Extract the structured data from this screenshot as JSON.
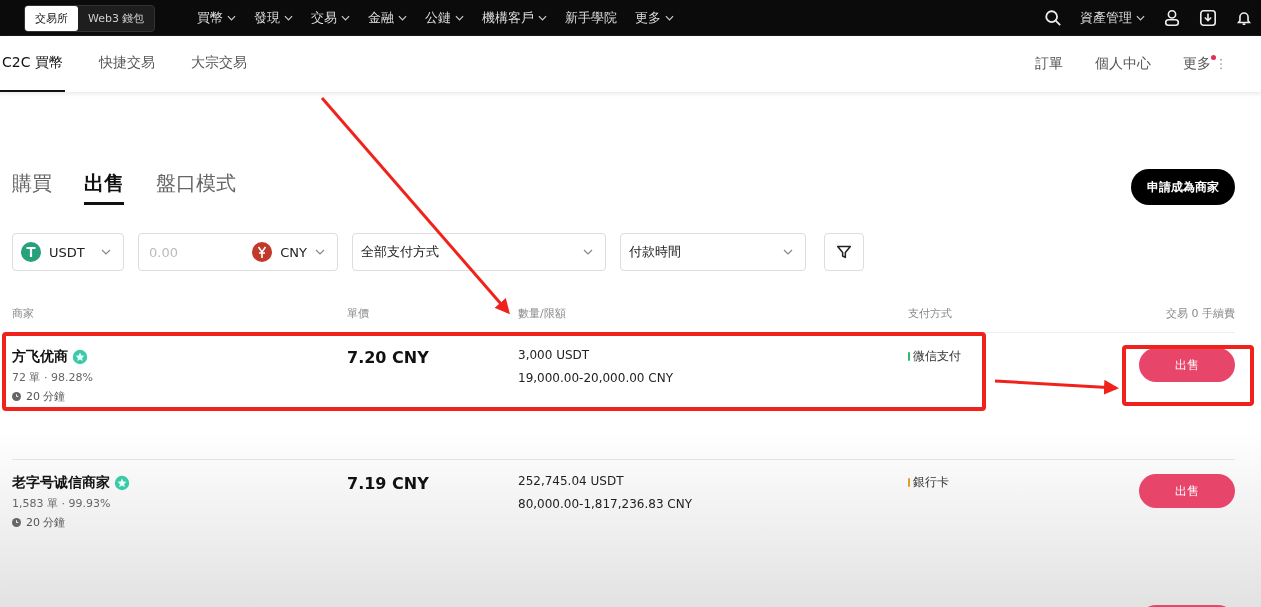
{
  "top_nav": {
    "switch": [
      {
        "label": "交易所",
        "selected": true
      },
      {
        "label": "Web3 錢包",
        "selected": false
      }
    ],
    "menu": [
      "買幣",
      "發現",
      "交易",
      "金融",
      "公鏈",
      "機構客戶"
    ],
    "plain": [
      "新手學院"
    ],
    "more": "更多",
    "assets": "資產管理"
  },
  "sub_nav": {
    "tabs": [
      {
        "label": "C2C 買幣",
        "selected": true
      },
      {
        "label": "快捷交易",
        "selected": false
      },
      {
        "label": "大宗交易",
        "selected": false
      }
    ],
    "right": [
      "訂單",
      "個人中心"
    ],
    "more": "更多",
    "more_dot": true
  },
  "trade_tabs": [
    {
      "label": "購買",
      "selected": false
    },
    {
      "label": "出售",
      "selected": true
    },
    {
      "label": "盤口模式",
      "selected": false
    }
  ],
  "apply_button": "申請成為商家",
  "filters": {
    "coin": "USDT",
    "amount_placeholder": "0.00",
    "fiat": "CNY",
    "payment": "全部支付方式",
    "time": "付款時間"
  },
  "columns": [
    "商家",
    "單價",
    "數量/限額",
    "支付方式",
    "交易 0 手續費"
  ],
  "rows": [
    {
      "name": "方飞优商",
      "stats": "72 單 · 98.28%",
      "time": "20 分鐘",
      "price": "7.20 CNY",
      "amount": "3,000 USDT",
      "limit": "19,000.00-20,000.00 CNY",
      "payment": "微信支付",
      "color": "#2eb872",
      "action": "出售"
    },
    {
      "name": "老字号诚信商家",
      "stats": "1,583 單 · 99.93%",
      "time": "20 分鐘",
      "price": "7.19 CNY",
      "amount": "252,745.04 USDT",
      "limit": "80,000.00-1,817,236.83 CNY",
      "payment": "銀行卡",
      "color": "#e0a020",
      "action": "出售"
    }
  ]
}
